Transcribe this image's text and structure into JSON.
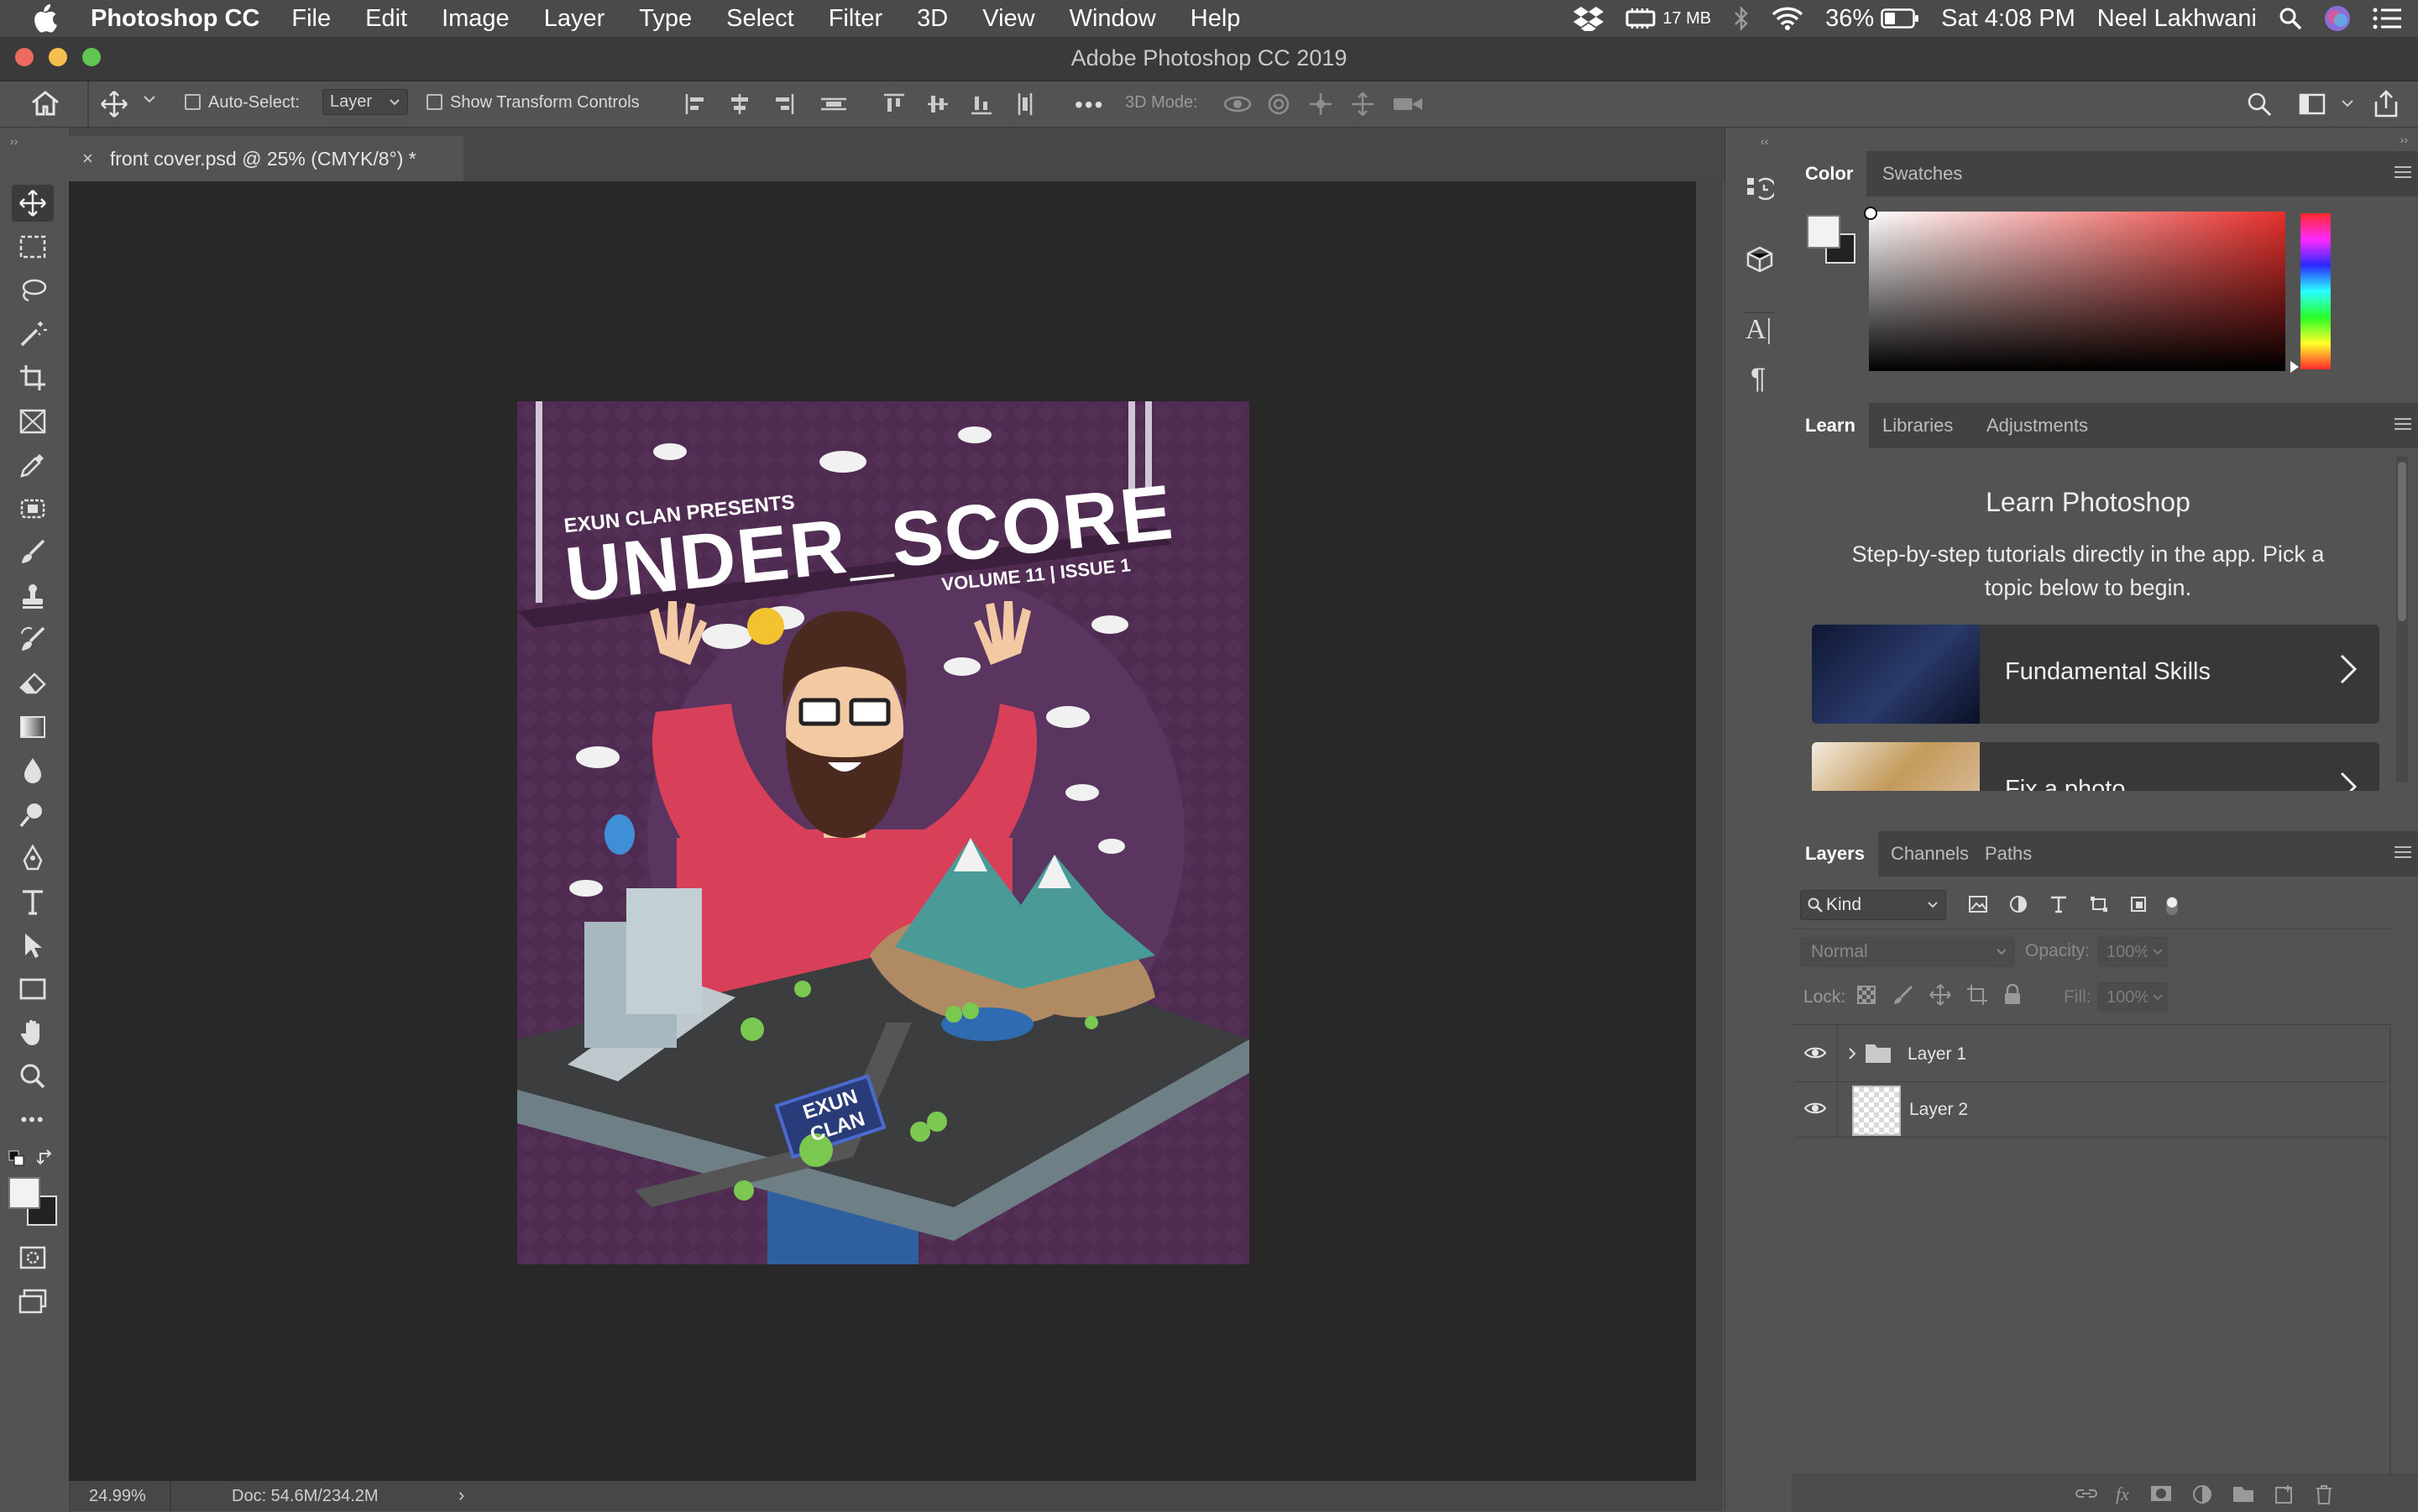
{
  "menubar": {
    "app_name": "Photoshop CC",
    "items": [
      "File",
      "Edit",
      "Image",
      "Layer",
      "Type",
      "Select",
      "Filter",
      "3D",
      "View",
      "Window",
      "Help"
    ],
    "memory": "17 MB",
    "battery": "36%",
    "clock": "Sat 4:08 PM",
    "user": "Neel Lakhwani"
  },
  "window": {
    "title": "Adobe Photoshop CC 2019"
  },
  "options_bar": {
    "auto_select_label": "Auto-Select:",
    "auto_select_value": "Layer",
    "show_transform_label": "Show Transform Controls",
    "mode_3d_label": "3D Mode:"
  },
  "document": {
    "tab_title": "front cover.psd @ 25% (CMYK/8°) *",
    "artwork": {
      "kicker": "EXUN CLAN PRESENTS",
      "title": "UNDER_SCORE",
      "issue": "VOLUME 11 | ISSUE 1",
      "sign_line1": "EXUN",
      "sign_line2": "CLAN"
    }
  },
  "status_bar": {
    "zoom": "24.99%",
    "doc_size": "Doc: 54.6M/234.2M"
  },
  "color_panel": {
    "tabs": [
      "Color",
      "Swatches"
    ],
    "active_tab": "Color"
  },
  "learn_panel": {
    "tabs": [
      "Learn",
      "Libraries",
      "Adjustments"
    ],
    "active_tab": "Learn",
    "heading": "Learn Photoshop",
    "description": "Step-by-step tutorials directly in the app. Pick a topic below to begin.",
    "cards": [
      {
        "label": "Fundamental Skills"
      },
      {
        "label": "Fix a photo"
      }
    ]
  },
  "layers_panel": {
    "tabs": [
      "Layers",
      "Channels",
      "Paths"
    ],
    "active_tab": "Layers",
    "filter_kind": "Kind",
    "blend_mode": "Normal",
    "opacity_label": "Opacity:",
    "opacity_value": "100%",
    "lock_label": "Lock:",
    "fill_label": "Fill:",
    "fill_value": "100%",
    "layers": [
      {
        "name": "Layer 1",
        "type": "group",
        "visible": true
      },
      {
        "name": "Layer 2",
        "type": "pixel",
        "visible": true
      }
    ]
  },
  "colors": {
    "accent_layer_select": "#535353",
    "poster_bg": "#4f2b52",
    "shirt": "#d8405a"
  }
}
